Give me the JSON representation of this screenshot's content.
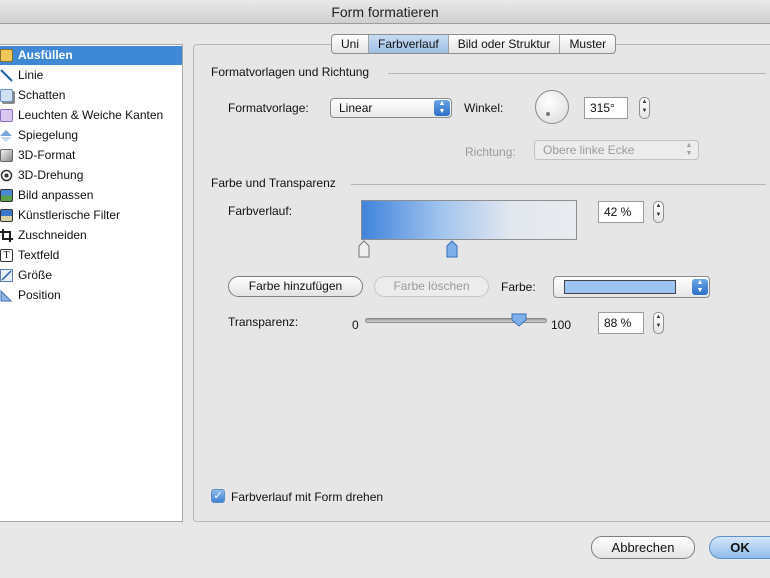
{
  "window": {
    "title": "Form formatieren"
  },
  "sidebar": {
    "items": [
      {
        "label": "Ausfüllen",
        "icon": "fill-icon"
      },
      {
        "label": "Linie",
        "icon": "line-icon"
      },
      {
        "label": "Schatten",
        "icon": "shadow-icon"
      },
      {
        "label": "Leuchten & Weiche Kanten",
        "icon": "glow-icon"
      },
      {
        "label": "Spiegelung",
        "icon": "reflection-icon"
      },
      {
        "label": "3D-Format",
        "icon": "3d-format-icon"
      },
      {
        "label": "3D-Drehung",
        "icon": "3d-rotation-icon"
      },
      {
        "label": "Bild anpassen",
        "icon": "picture-adjust-icon"
      },
      {
        "label": "Künstlerische Filter",
        "icon": "artistic-filter-icon"
      },
      {
        "label": "Zuschneiden",
        "icon": "crop-icon"
      },
      {
        "label": "Textfeld",
        "icon": "textbox-icon"
      },
      {
        "label": "Größe",
        "icon": "size-icon"
      },
      {
        "label": "Position",
        "icon": "position-icon"
      }
    ],
    "selected": "Ausfüllen"
  },
  "tabs": {
    "items": [
      "Uni",
      "Farbverlauf",
      "Bild oder Struktur",
      "Muster"
    ],
    "active": "Farbverlauf"
  },
  "presets": {
    "section_title": "Formatvorlagen und Richtung",
    "preset_label": "Formatvorlage:",
    "preset_value": "Linear",
    "angle_label": "Winkel:",
    "angle_value": "315°",
    "direction_label": "Richtung:",
    "direction_value": "Obere linke Ecke"
  },
  "color_transparency": {
    "section_title": "Farbe und Transparenz",
    "gradient_label": "Farbverlauf:",
    "gradient_position": "42 %",
    "add_color_button": "Farbe hinzufügen",
    "delete_color_button": "Farbe löschen",
    "color_label": "Farbe:",
    "color_value": "#9cc3f1",
    "transparency_label": "Transparenz:",
    "transparency_min": "0",
    "transparency_max": "100",
    "transparency_value": "88 %",
    "transparency_level": 88
  },
  "options": {
    "rotate_with_shape_label": "Farbverlauf mit Form drehen",
    "rotate_with_shape_checked": true
  },
  "footer": {
    "cancel_label": "Abbrechen",
    "ok_label": "OK"
  },
  "colors": {
    "accent": "#3f88d6",
    "selected_color": "#9cc3f1"
  }
}
